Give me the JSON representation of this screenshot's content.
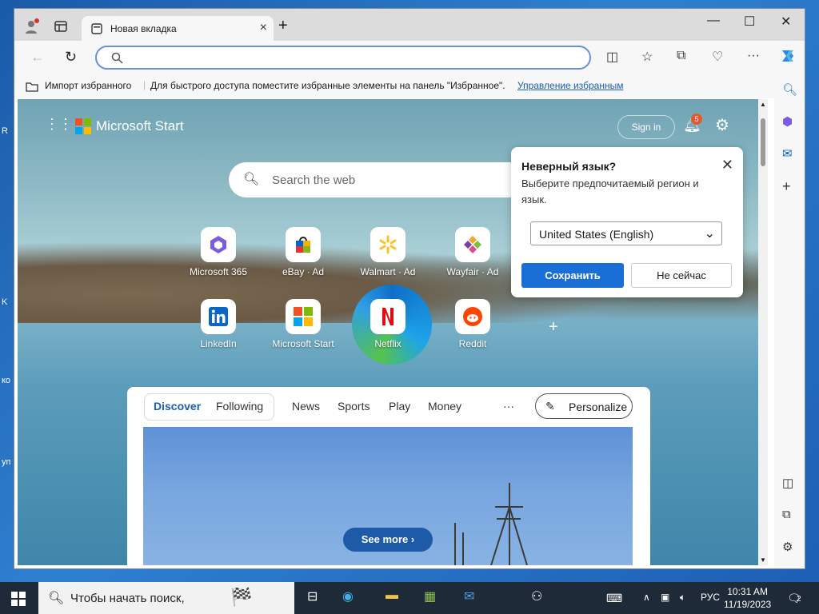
{
  "desktop": {
    "left_fragments": [
      "R",
      "K",
      "ко",
      "уп"
    ]
  },
  "browser": {
    "tab_title": "Новая вкладка",
    "new_tab_symbol": "+",
    "window_controls": {
      "minimize": "—",
      "maximize": "☐",
      "close": "✕"
    },
    "address": {
      "value": "",
      "placeholder": ""
    },
    "favorites_bar": {
      "import_label": "Импорт избранного",
      "hint": "Для быстрого доступа поместите избранные элементы на панель \"Избранное\".",
      "manage_link": "Управление избранным"
    }
  },
  "start_page": {
    "brand": "Microsoft Start",
    "sign_in": "Sign in",
    "notifications_count": "5",
    "search_placeholder": "Search the web",
    "tiles": [
      {
        "label": "Microsoft 365",
        "icon": "m365-icon"
      },
      {
        "label": "eBay · Ad",
        "icon": "ebay-icon"
      },
      {
        "label": "Walmart · Ad",
        "icon": "walmart-icon"
      },
      {
        "label": "Wayfair · Ad",
        "icon": "wayfair-icon"
      },
      {
        "label": "LinkedIn",
        "icon": "linkedin-icon"
      },
      {
        "label": "Microsoft Start",
        "icon": "msstart-icon"
      },
      {
        "label": "Netflix",
        "icon": "netflix-icon"
      },
      {
        "label": "Reddit",
        "icon": "reddit-icon"
      }
    ]
  },
  "language_popup": {
    "title": "Неверный язык?",
    "description": "Выберите предпочитаемый регион и язык.",
    "selected_region": "United States (English)",
    "save_label": "Сохранить",
    "later_label": "Не сейчас"
  },
  "feed": {
    "tabs": [
      "Discover",
      "Following",
      "News",
      "Sports",
      "Play",
      "Money"
    ],
    "more": "···",
    "personalize": "Personalize",
    "see_more": "See more"
  },
  "taskbar": {
    "search_placeholder": "Чтобы начать поиск,",
    "language": "РУС",
    "time": "10:31 AM",
    "date": "11/19/2023",
    "notification_count": "2"
  },
  "colors": {
    "accent": "#1a6fd6",
    "feed_button": "#1d5aa8",
    "badge": "#e5572f"
  }
}
